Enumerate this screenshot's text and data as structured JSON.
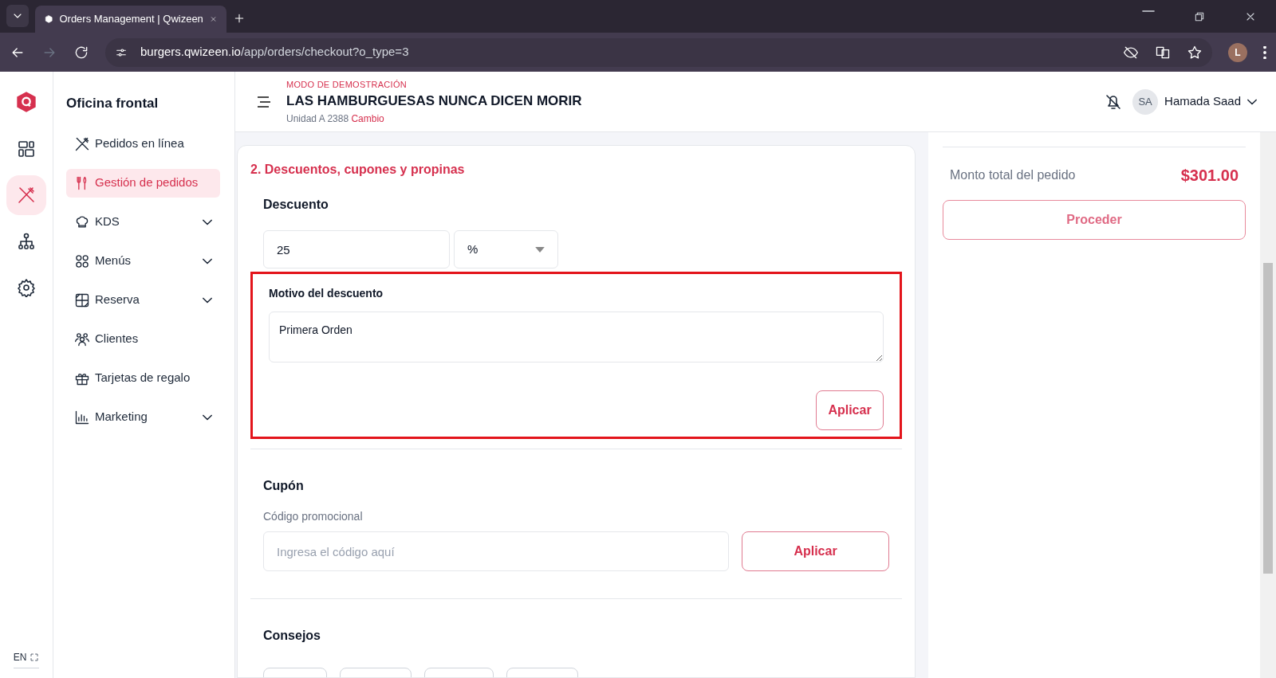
{
  "browser": {
    "tab_title": "Orders Management | Qwizeen",
    "url_host": "burgers.qwizeen.io",
    "url_path": "/app/orders/checkout?o_type=3",
    "profile_initial": "L"
  },
  "rail": [
    {
      "kind": "dashboard",
      "selected": false
    },
    {
      "kind": "orders",
      "selected": true
    },
    {
      "kind": "hierarchy",
      "selected": false
    },
    {
      "kind": "settings",
      "selected": false
    }
  ],
  "language": "EN",
  "sidebar": {
    "title": "Oficina frontal",
    "items": [
      {
        "kind": "online",
        "label": "Pedidos en línea",
        "selected": false,
        "expandable": false
      },
      {
        "kind": "cutlery",
        "label": "Gestión de pedidos",
        "selected": true,
        "expandable": false
      },
      {
        "kind": "chef",
        "label": "KDS",
        "selected": false,
        "expandable": true
      },
      {
        "kind": "grid",
        "label": "Menús",
        "selected": false,
        "expandable": true
      },
      {
        "kind": "table",
        "label": "Reserva",
        "selected": false,
        "expandable": true
      },
      {
        "kind": "people",
        "label": "Clientes",
        "selected": false,
        "expandable": false
      },
      {
        "kind": "gift",
        "label": "Tarjetas de regalo",
        "selected": false,
        "expandable": false
      },
      {
        "kind": "chart",
        "label": "Marketing",
        "selected": false,
        "expandable": true
      }
    ]
  },
  "header": {
    "mode": "MODO DE DEMOSTRACIÓN",
    "restaurant": "LAS HAMBURGUESAS NUNCA DICEN MORIR",
    "unit": "Unidad A 2388",
    "change_link": "Cambio",
    "user_initials": "SA",
    "user_name": "Hamada Saad"
  },
  "section": {
    "title": "2. Descuentos, cupones y propinas",
    "discount": {
      "heading": "Descuento",
      "value": "25",
      "unit": "%",
      "reason_label": "Motivo del descuento",
      "reason_value": "Primera Orden",
      "apply": "Aplicar",
      "highlighted": true
    },
    "coupon": {
      "heading": "Cupón",
      "label": "Código promocional",
      "placeholder": "Ingresa el código aquí",
      "apply": "Aplicar"
    },
    "tips": {
      "heading": "Consejos"
    }
  },
  "summary": {
    "total_label": "Monto total del pedido",
    "total_value": "$301.00",
    "proceed": "Proceder"
  }
}
